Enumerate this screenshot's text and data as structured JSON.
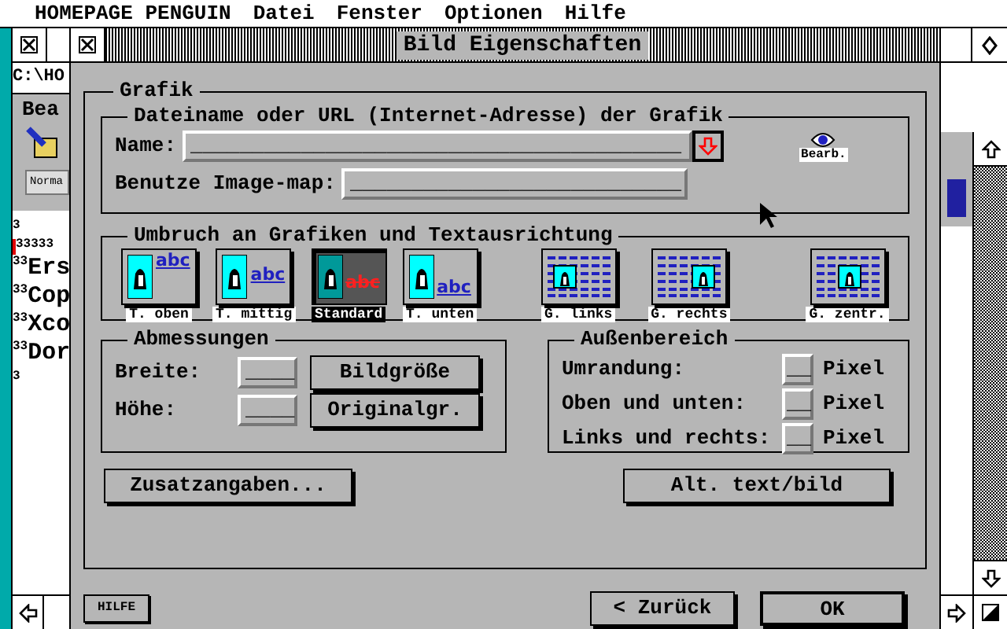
{
  "menu_bar": {
    "app": "HOMEPAGE PENGUIN",
    "items": [
      "Datei",
      "Fenster",
      "Optionen",
      "Hilfe"
    ]
  },
  "background_window": {
    "path": "C:\\HO",
    "toolbar_label": "Bea",
    "style_button": "Norma",
    "lines": [
      {
        "text": "3"
      },
      {
        "text": "33333",
        "marker": true
      },
      {
        "prefix": "33",
        "text": "Ers"
      },
      {
        "prefix": "33",
        "text": "Cop"
      },
      {
        "prefix": "33",
        "text": "Xco"
      },
      {
        "prefix": "33",
        "text": "Dor"
      },
      {
        "text": "3"
      }
    ]
  },
  "dialog": {
    "title": "Bild Eigenschaften",
    "group_title": "Grafik",
    "file_group": {
      "title": "Dateiname oder URL (Internet-Adresse) der Grafik",
      "name_label": "Name:",
      "name_value": "________________________________________",
      "edit_label": "Bearb.",
      "imagemap_label": "Benutze Image-map:",
      "imagemap_value": "___________________________"
    },
    "wrap_group": {
      "title": "Umbruch an Grafiken und Textausrichtung",
      "options": [
        {
          "kind": "text-top",
          "label": "T. oben",
          "sample": "abc",
          "selected": false
        },
        {
          "kind": "text-middle",
          "label": "T. mittig",
          "sample": "abc",
          "selected": false
        },
        {
          "kind": "standard",
          "label": "Standard",
          "sample": "abc",
          "selected": true
        },
        {
          "kind": "text-bottom",
          "label": "T. unten",
          "sample": "abc",
          "selected": false
        },
        {
          "kind": "image-left",
          "label": "G. links",
          "selected": false
        },
        {
          "kind": "image-right",
          "label": "G. rechts",
          "selected": false
        },
        {
          "kind": "image-center",
          "label": "G. zentr.",
          "selected": false
        }
      ]
    },
    "size_group": {
      "title": "Abmessungen",
      "rows": [
        {
          "label": "Breite:",
          "value": "____",
          "button": "Bildgröße"
        },
        {
          "label": "Höhe:",
          "value": "____",
          "button": "Originalgr."
        }
      ]
    },
    "margin_group": {
      "title": "Außenbereich",
      "rows": [
        {
          "label": "Umrandung:",
          "value": "__",
          "unit": "Pixel"
        },
        {
          "label": "Oben und unten:",
          "value": "__",
          "unit": "Pixel"
        },
        {
          "label": "Links und rechts:",
          "value": "__",
          "unit": "Pixel"
        }
      ]
    },
    "extra_button": "Zusatzangaben...",
    "alt_button": "Alt. text/bild",
    "help_button": "HILFE",
    "back_button": "< Zurück",
    "ok_button": "OK"
  }
}
